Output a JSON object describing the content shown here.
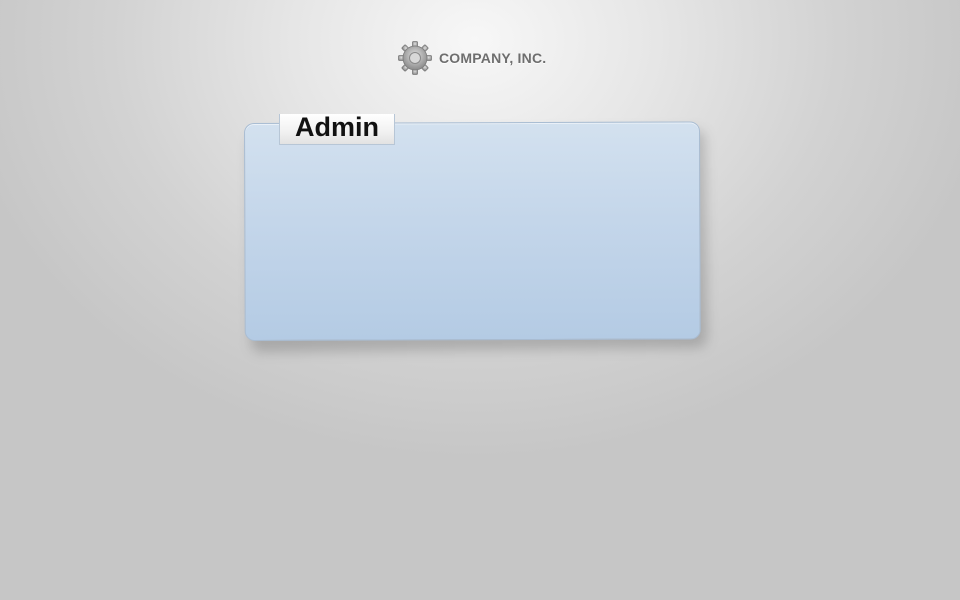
{
  "header": {
    "logo_icon": "gear-icon",
    "company_name": "COMPANY, INC."
  },
  "panel": {
    "tab_label": "Admin"
  },
  "colors": {
    "panel_top": "#d3e1ef",
    "panel_bottom": "#b4cbe4",
    "logo_text": "#6e6e6e",
    "tab_text": "#111111"
  }
}
